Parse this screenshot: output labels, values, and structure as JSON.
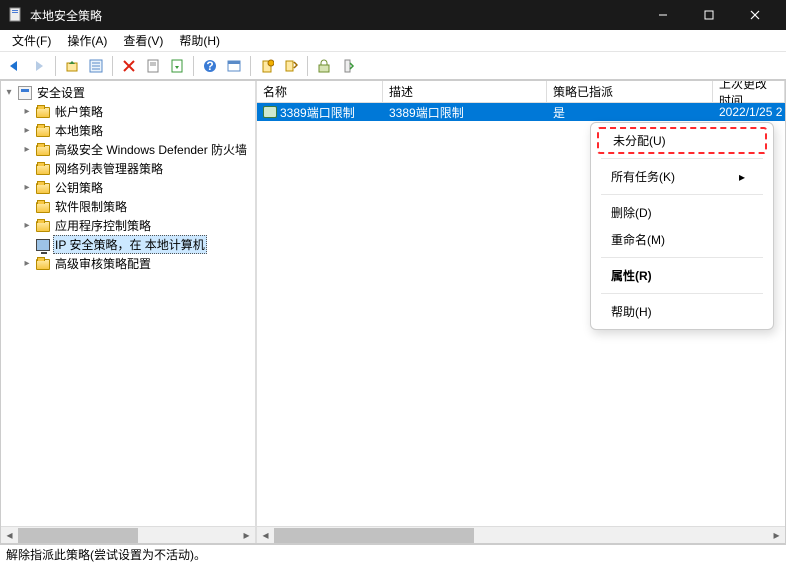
{
  "title": "本地安全策略",
  "menus": {
    "file": "文件(F)",
    "action": "操作(A)",
    "view": "查看(V)",
    "help": "帮助(H)"
  },
  "tree": {
    "root": "安全设置",
    "items": [
      {
        "label": "帐户策略",
        "expandable": true
      },
      {
        "label": "本地策略",
        "expandable": true
      },
      {
        "label": "高级安全 Windows Defender 防火墙",
        "expandable": true
      },
      {
        "label": "网络列表管理器策略",
        "expandable": false
      },
      {
        "label": "公钥策略",
        "expandable": true
      },
      {
        "label": "软件限制策略",
        "expandable": false
      },
      {
        "label": "应用程序控制策略",
        "expandable": true
      },
      {
        "label": "IP 安全策略，在 本地计算机",
        "expandable": false,
        "selected": true,
        "icontype": "monitor"
      },
      {
        "label": "高级审核策略配置",
        "expandable": true
      }
    ]
  },
  "columns": {
    "name": "名称",
    "desc": "描述",
    "assigned": "策略已指派",
    "modified": "上次更改时间"
  },
  "rows": [
    {
      "name": "3389端口限制",
      "desc": "3389端口限制",
      "assigned": "是",
      "modified": "2022/1/25 2"
    }
  ],
  "context_menu": {
    "unassign": "未分配(U)",
    "all_tasks": "所有任务(K)",
    "delete": "删除(D)",
    "rename": "重命名(M)",
    "properties": "属性(R)",
    "help": "帮助(H)"
  },
  "status": "解除指派此策略(尝试设置为不活动)。"
}
